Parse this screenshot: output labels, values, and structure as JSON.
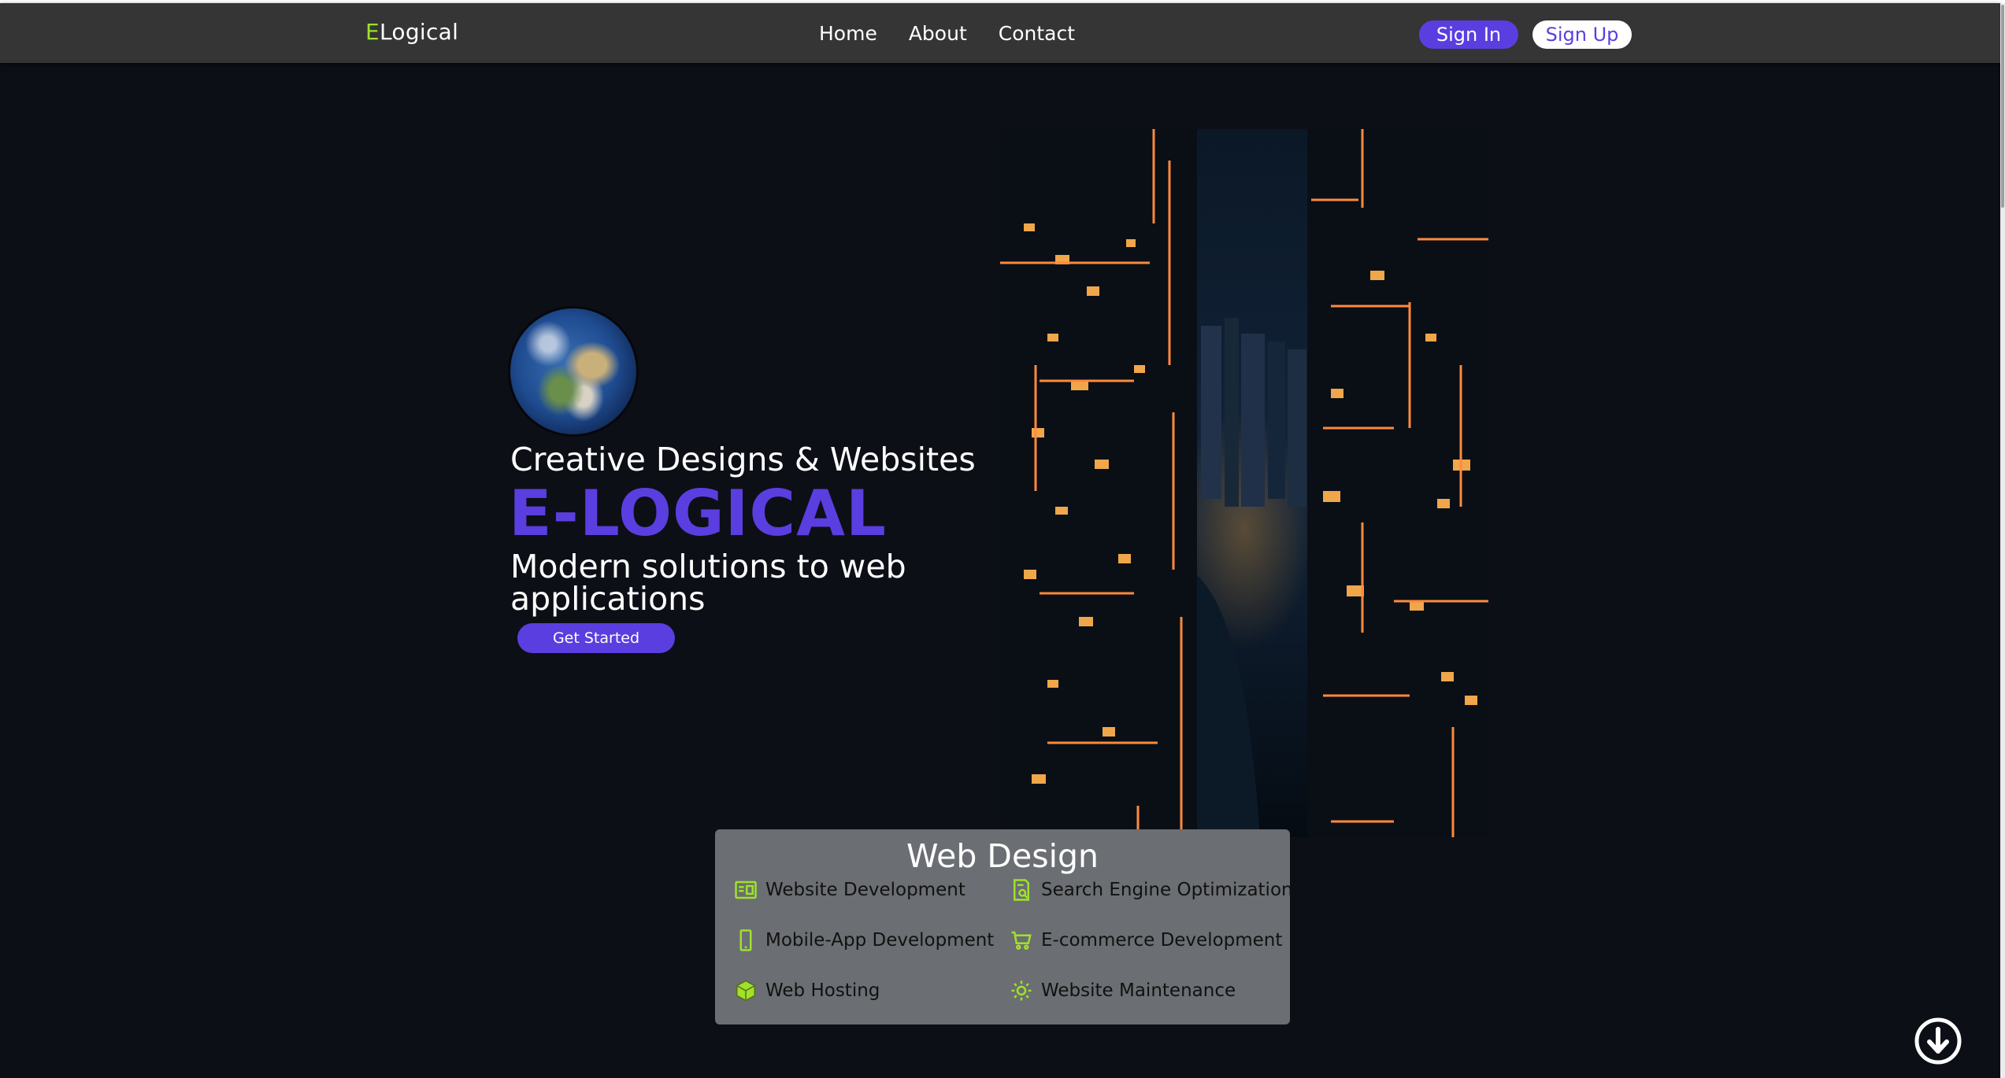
{
  "navbar": {
    "brand_accent": "E",
    "brand_rest": "Logical",
    "links": [
      "Home",
      "About",
      "Contact"
    ],
    "sign_in": "Sign In",
    "sign_up": "Sign Up"
  },
  "hero": {
    "subtitle": "Creative Designs & Websites",
    "title": "E-LOGICAL",
    "description": "Modern solutions to web applications",
    "cta": "Get Started"
  },
  "services": {
    "title": "Web Design",
    "items": [
      {
        "label": "Website Development",
        "icon": "website-icon"
      },
      {
        "label": "Search Engine Optimization",
        "icon": "seo-icon"
      },
      {
        "label": "Mobile-App Development",
        "icon": "mobile-icon"
      },
      {
        "label": "E-commerce Development",
        "icon": "cart-icon"
      },
      {
        "label": "Web Hosting",
        "icon": "hosting-icon"
      },
      {
        "label": "Website Maintenance",
        "icon": "gear-icon"
      }
    ]
  },
  "colors": {
    "accent": "#5b3ee0",
    "brand_green": "#9ee22a",
    "background": "#0d0f17",
    "navbar": "#353535",
    "card": "#6b6e72"
  }
}
